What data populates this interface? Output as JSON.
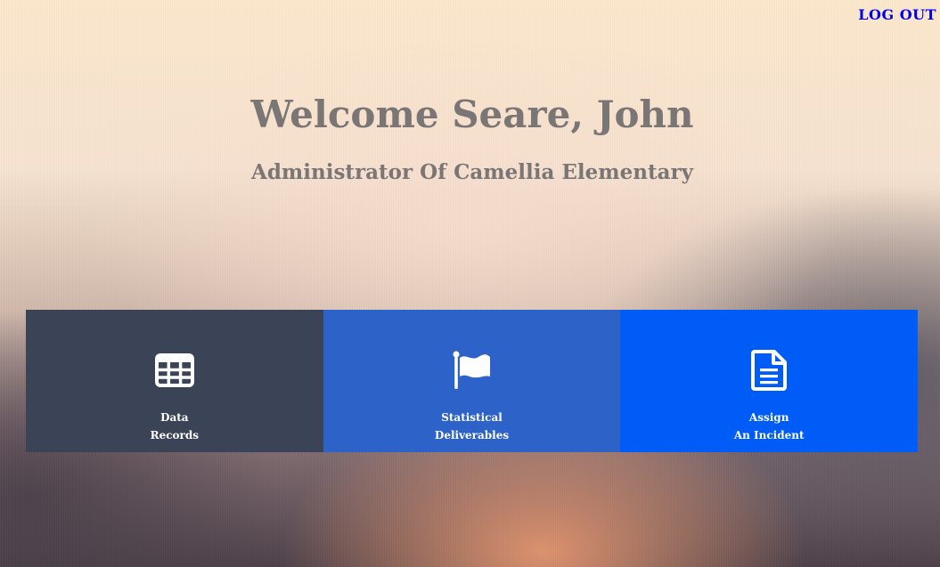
{
  "header": {
    "logout_label": "LOG OUT"
  },
  "main": {
    "welcome": "Welcome Seare, John",
    "role": "Administrator Of Camellia Elementary"
  },
  "tiles": [
    {
      "line1": "Data",
      "line2": "Records",
      "icon": "table-icon",
      "color": "#3b4456"
    },
    {
      "line1": "Statistical",
      "line2": "Deliverables",
      "icon": "flag-icon",
      "color": "#2d63c8"
    },
    {
      "line1": "Assign",
      "line2": "An Incident",
      "icon": "document-icon",
      "color": "#005cf6"
    }
  ]
}
